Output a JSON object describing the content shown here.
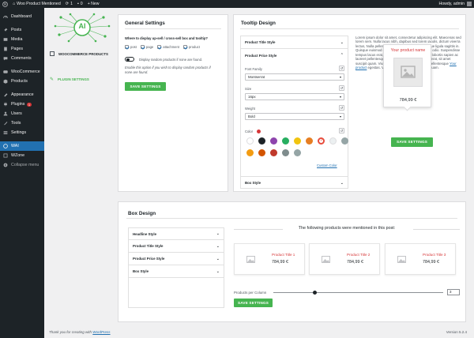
{
  "adminbar": {
    "site_name": "Woo Product Mentioned",
    "updates": "1",
    "comments": "0",
    "new_label": "+ New",
    "howdy": "Howdy, admin"
  },
  "sidebar": {
    "items": [
      {
        "label": "Dashboard",
        "icon": "dashboard-icon"
      },
      {
        "label": "Posts",
        "icon": "pin-icon"
      },
      {
        "label": "Media",
        "icon": "media-icon"
      },
      {
        "label": "Pages",
        "icon": "pages-icon"
      },
      {
        "label": "Comments",
        "icon": "comments-icon"
      },
      {
        "label": "WooCommerce",
        "icon": "woocommerce-icon"
      },
      {
        "label": "Products",
        "icon": "products-icon"
      },
      {
        "label": "Appearance",
        "icon": "appearance-icon"
      },
      {
        "label": "Plugins",
        "icon": "plugins-icon",
        "badge": "1"
      },
      {
        "label": "Users",
        "icon": "users-icon"
      },
      {
        "label": "Tools",
        "icon": "tools-icon"
      },
      {
        "label": "Settings",
        "icon": "settings-icon"
      },
      {
        "label": "WAI",
        "icon": "wai-icon"
      },
      {
        "label": "WZone",
        "icon": "wzone-icon"
      }
    ],
    "collapse_label": "Collapse menu"
  },
  "plugin_nav": {
    "logo_text": "AI",
    "items": [
      "WOOCOMMERCE PRODUCTS",
      "PLUGIN SETTINGS"
    ]
  },
  "general": {
    "title": "General Settings",
    "question": "Where to display up-sell / cross-sell box and tooltip?",
    "options": [
      {
        "label": "post",
        "checked": true
      },
      {
        "label": "page",
        "checked": true
      },
      {
        "label": "attachment",
        "checked": true
      },
      {
        "label": "product",
        "checked": true
      }
    ],
    "toggle_label": "Display random products if none are found.",
    "hint": "Enable this option if you wish to display random products if none are found.",
    "save_label": "SAVE SETTINGS"
  },
  "tooltip": {
    "title": "Tooltip Design",
    "sections": [
      "Product Title Style",
      "Product Price Style",
      "Box Style"
    ],
    "font_family_label": "Font Family",
    "font_family_value": "Montserrat",
    "size_label": "Size",
    "size_value": "16px",
    "weight_label": "Weight",
    "weight_value": "Bold",
    "color_label": "Color",
    "selected_color": "#d63638",
    "swatches": [
      "#ffffff",
      "#1d2327",
      "#8e44ad",
      "#27ae60",
      "#f1c40f",
      "#e67e22",
      "#e74c3c",
      "#ecf0f1",
      "#95a5a6",
      "#f39c12",
      "#d35400",
      "#c0392b",
      "#7f8c8d",
      "#95a5a6"
    ],
    "custom_color_label": "Custom Color",
    "preview_text": "Lorem ipsum dolor sit amet, consectetur adipiscing elit. Maecenas sed lorem sem. Nulla lacus nibh, dapibus sed lorem iaculis, dictum viverra lectus, Nulla pellentesque mi metus, ac pellentesque ligula sagittis in. Quisque euismod dui vitae tellus. Etiam quis turpis odio. Suspendisse tempus lacus erat, sit amet lacinia lorem. Vivamus lobortis sapien ac laoreet pellentesque. Donec quis augue fames ac erat, sit amet suscipit quam. Vivamus nisi justo euismod justo. Pellentesque",
    "preview_link": "Your product",
    "preview_tail": "egestas. Vivamus tellus, nunc sodales aliquam.",
    "card_title": "Your product name",
    "card_price": "784,99 €",
    "save_label": "SAVE SETTINGS"
  },
  "box": {
    "title": "Box Design",
    "sections": [
      "Headline Style",
      "Product Title Style",
      "Product Price Style",
      "Box Style"
    ],
    "headline": "The following products were mentioned in this post:",
    "products": [
      {
        "name": "Product Title 1",
        "price": "784,99 €"
      },
      {
        "name": "Product Title 2",
        "price": "784,99 €"
      },
      {
        "name": "Product Title 3",
        "price": "784,99 €"
      }
    ],
    "per_column_label": "Products per Column",
    "per_column_value": "3",
    "save_label": "SAVE SETTINGS"
  },
  "footer": {
    "thanks_prefix": "Thank you for creating with",
    "thanks_link": "WordPress",
    "version": "Version 5.2.4"
  }
}
